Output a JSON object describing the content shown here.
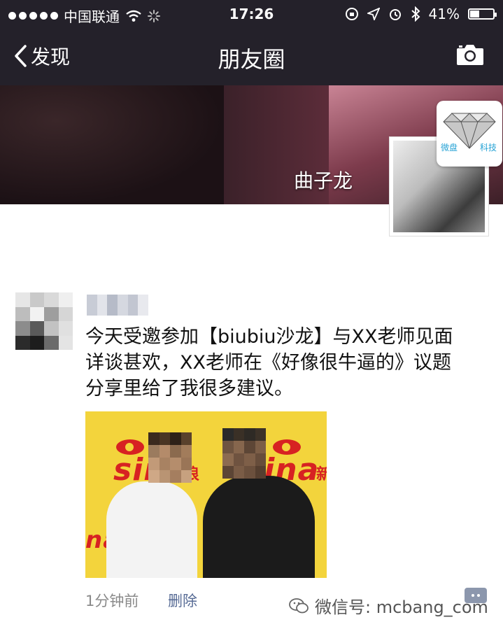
{
  "status_bar": {
    "carrier": "中国联通",
    "time": "17:26",
    "battery": "41%",
    "battery_level": 0.41
  },
  "nav": {
    "back_label": "发现",
    "title": "朋友圈"
  },
  "profile": {
    "username": "曲子龙",
    "badge_left": "微盘",
    "badge_right": "科技"
  },
  "post": {
    "text_lines": [
      "今天受邀参加【biubiu沙龙】与XX老师见面",
      "详谈甚欢，XX老师在《好像很牛逼的》议题",
      "分享里给了我很多建议。"
    ],
    "photo_sign_left": "sin",
    "photo_sign_left_cn": "新浪",
    "photo_sign_right": "sina",
    "photo_sign_right_cn": "新",
    "photo_sign_bottom": "na",
    "time": "1分钟前",
    "delete_label": "删除"
  },
  "watermark": {
    "text": "微信号: mcbang_com"
  },
  "colors": {
    "nav_bg": "#24212a",
    "link": "#576b95",
    "meta_gray": "#8a8a8a",
    "sina_red": "#d72222",
    "photo_yellow": "#f3d43c"
  }
}
